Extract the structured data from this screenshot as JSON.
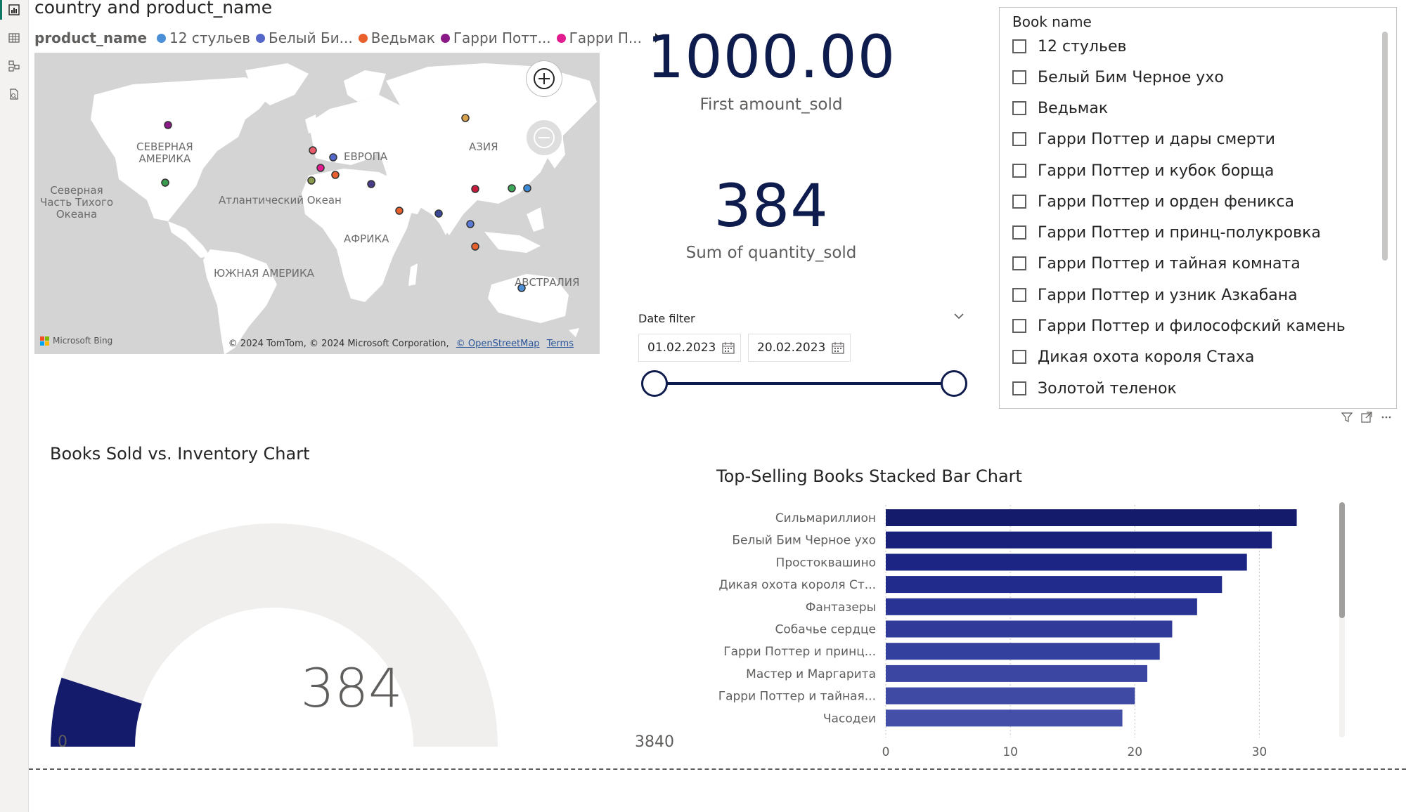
{
  "rail": {
    "icons": [
      "report-view-icon",
      "table-view-icon",
      "model-view-icon",
      "dax-query-icon"
    ]
  },
  "map": {
    "title": "country and product_name",
    "legend": {
      "title": "product_name",
      "items": [
        {
          "label": "12 стульев",
          "color": "#4a8fd8"
        },
        {
          "label": "Белый Би...",
          "color": "#5567c8"
        },
        {
          "label": "Ведьмак",
          "color": "#e8602c"
        },
        {
          "label": "Гарри Потт...",
          "color": "#8b1a89"
        },
        {
          "label": "Гарри П...",
          "color": "#e21c8f"
        }
      ]
    },
    "labels": {
      "north_america": "СЕВЕРНАЯ\nАМЕРИКА",
      "north_pacific": "Северная\nЧасть Тихого\nОкеана",
      "atlantic": "Атлантический Океан",
      "europe": "ЕВРОПА",
      "asia": "АЗИЯ",
      "africa": "АФРИКА",
      "south_america": "ЮЖНАЯ АМЕРИКА",
      "australia": "АВСТРАЛИЯ"
    },
    "bing": "Microsoft Bing",
    "attribution": "© 2024 TomTom, © 2024 Microsoft Corporation,",
    "osm_link": "© OpenStreetMap",
    "terms_link": "Terms"
  },
  "cards": {
    "amount": {
      "value": "1000.00",
      "label": "First amount_sold"
    },
    "quantity": {
      "value": "384",
      "label": "Sum of quantity_sold"
    }
  },
  "date_filter": {
    "title": "Date filter",
    "start": "01.02.2023",
    "end": "20.02.2023"
  },
  "slicer": {
    "title": "Book name",
    "items": [
      "12 стульев",
      "Белый Бим Черное ухо",
      "Ведьмак",
      "Гарри Поттер и дары смерти",
      "Гарри Поттер и кубок борща",
      "Гарри Поттер и орден феникса",
      "Гарри Поттер и принц-полукровка",
      "Гарри Поттер и тайная комната",
      "Гарри Поттер и узник Азкабана",
      "Гарри Поттер и философский камень",
      "Дикая охота короля Стаха",
      "Золотой теленок"
    ]
  },
  "gauge": {
    "title": "Books Sold vs. Inventory Chart",
    "value": 384,
    "value_label": "384",
    "min_label": "0",
    "max_label": "3840",
    "min": 0,
    "max": 3840,
    "fill_color": "#141b6b",
    "track_color": "#f0efee"
  },
  "chart_data": {
    "type": "bar",
    "title": "Top-Selling Books Stacked Bar Chart",
    "categories": [
      "Сильмариллион",
      "Белый Бим Черное ухо",
      "Простоквашино",
      "Дикая охота короля Ст...",
      "Фантазеры",
      "Собачье сердце",
      "Гарри Поттер и принц...",
      "Мастер и Маргарита",
      "Гарри Поттер и тайная...",
      "Часодеи"
    ],
    "values": [
      33,
      31,
      29,
      27,
      25,
      23,
      22,
      21,
      20,
      19
    ],
    "colors": [
      "#141b6b",
      "#18207a",
      "#1c2583",
      "#212b8c",
      "#293393",
      "#303a99",
      "#34409d",
      "#3a46a1",
      "#3e4aa4",
      "#4450a8"
    ],
    "xlim": [
      0,
      35
    ],
    "xticks": [
      "0",
      "10",
      "20",
      "30"
    ],
    "grid": true
  }
}
